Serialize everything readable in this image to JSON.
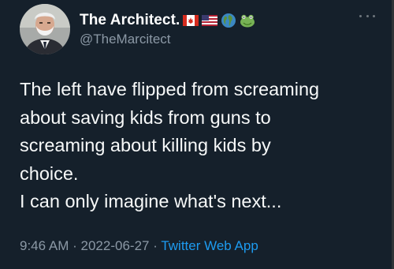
{
  "author": {
    "display_name": "The Architect.",
    "handle": "@TheMarcitect",
    "avatar_icon": "elderly-man-avatar",
    "badges": [
      "canada-flag-icon",
      "usa-flag-icon",
      "globe-icon",
      "frog-icon"
    ]
  },
  "tweet": {
    "text": "The left have flipped from screaming\nabout saving kids from guns to\nscreaming about killing kids by\nchoice.\nI can only imagine what's next..."
  },
  "meta": {
    "time": "9:46 AM",
    "separator": "·",
    "date": "2022-06-27",
    "source": "Twitter Web App"
  },
  "colors": {
    "background": "#15202b",
    "text": "#f7f9f9",
    "secondary": "#8b98a5",
    "link": "#1d9bf0"
  }
}
